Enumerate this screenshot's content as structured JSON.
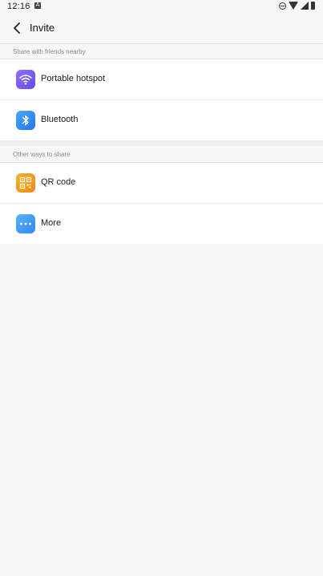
{
  "status_bar": {
    "time": "12:16"
  },
  "app_bar": {
    "title": "Invite"
  },
  "sections": [
    {
      "header": "Share with friends nearby",
      "items": [
        {
          "label": "Portable hotspot",
          "icon": "wifi-icon",
          "color": "#7c5cf5"
        },
        {
          "label": "Bluetooth",
          "icon": "bluetooth-icon",
          "color": "#2f8df6"
        }
      ]
    },
    {
      "header": "Other ways to share",
      "items": [
        {
          "label": "QR code",
          "icon": "qr-code-icon",
          "color": "#f39a12"
        },
        {
          "label": "More",
          "icon": "more-icon",
          "color": "#3b9bf6"
        }
      ]
    }
  ]
}
